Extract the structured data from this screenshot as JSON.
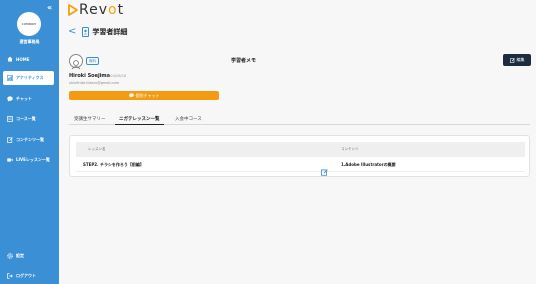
{
  "sidebar": {
    "collapse_label": "«",
    "logo_text": "COMPANY",
    "org_name": "運営事務局",
    "items": [
      {
        "label": "HOME",
        "icon": "home-icon"
      },
      {
        "label": "アナリティクス",
        "icon": "analytics-icon"
      },
      {
        "label": "チャット",
        "icon": "chat-icon"
      },
      {
        "label": "コース一覧",
        "icon": "course-icon"
      },
      {
        "label": "コンテンツ一覧",
        "icon": "content-icon"
      },
      {
        "label": "LIVEレッスン一覧",
        "icon": "live-icon"
      },
      {
        "label": "設定",
        "icon": "settings-icon"
      },
      {
        "label": "ログアウト",
        "icon": "logout-icon"
      }
    ]
  },
  "brand": {
    "prefix": "Rev",
    "o": "o",
    "suffix": "t"
  },
  "page": {
    "back": "<",
    "title": "学習者詳細"
  },
  "learner": {
    "badge": "無料",
    "name": "Hiroki Soejima",
    "date": "2024/06/18",
    "email": "shinfinite.hikaru@gmail.com",
    "chat_button": "個別チャット"
  },
  "memo": {
    "title": "学習者メモ",
    "edit_label": "編集"
  },
  "tabs": [
    {
      "label": "受講生サマリー",
      "active": false
    },
    {
      "label": "ニガテレッスン一覧",
      "active": true
    },
    {
      "label": "入会中コース",
      "active": false
    }
  ],
  "table": {
    "headers": [
      "レッスン名",
      "コンテンツ"
    ],
    "rows": [
      {
        "lesson": "STEP2. チラシを作ろう【前編】",
        "content": "1.Adobe Illustratorの概要"
      }
    ]
  },
  "colors": {
    "primary": "#3b8fd5",
    "accent": "#f39c12",
    "dark": "#1c2b3f"
  }
}
